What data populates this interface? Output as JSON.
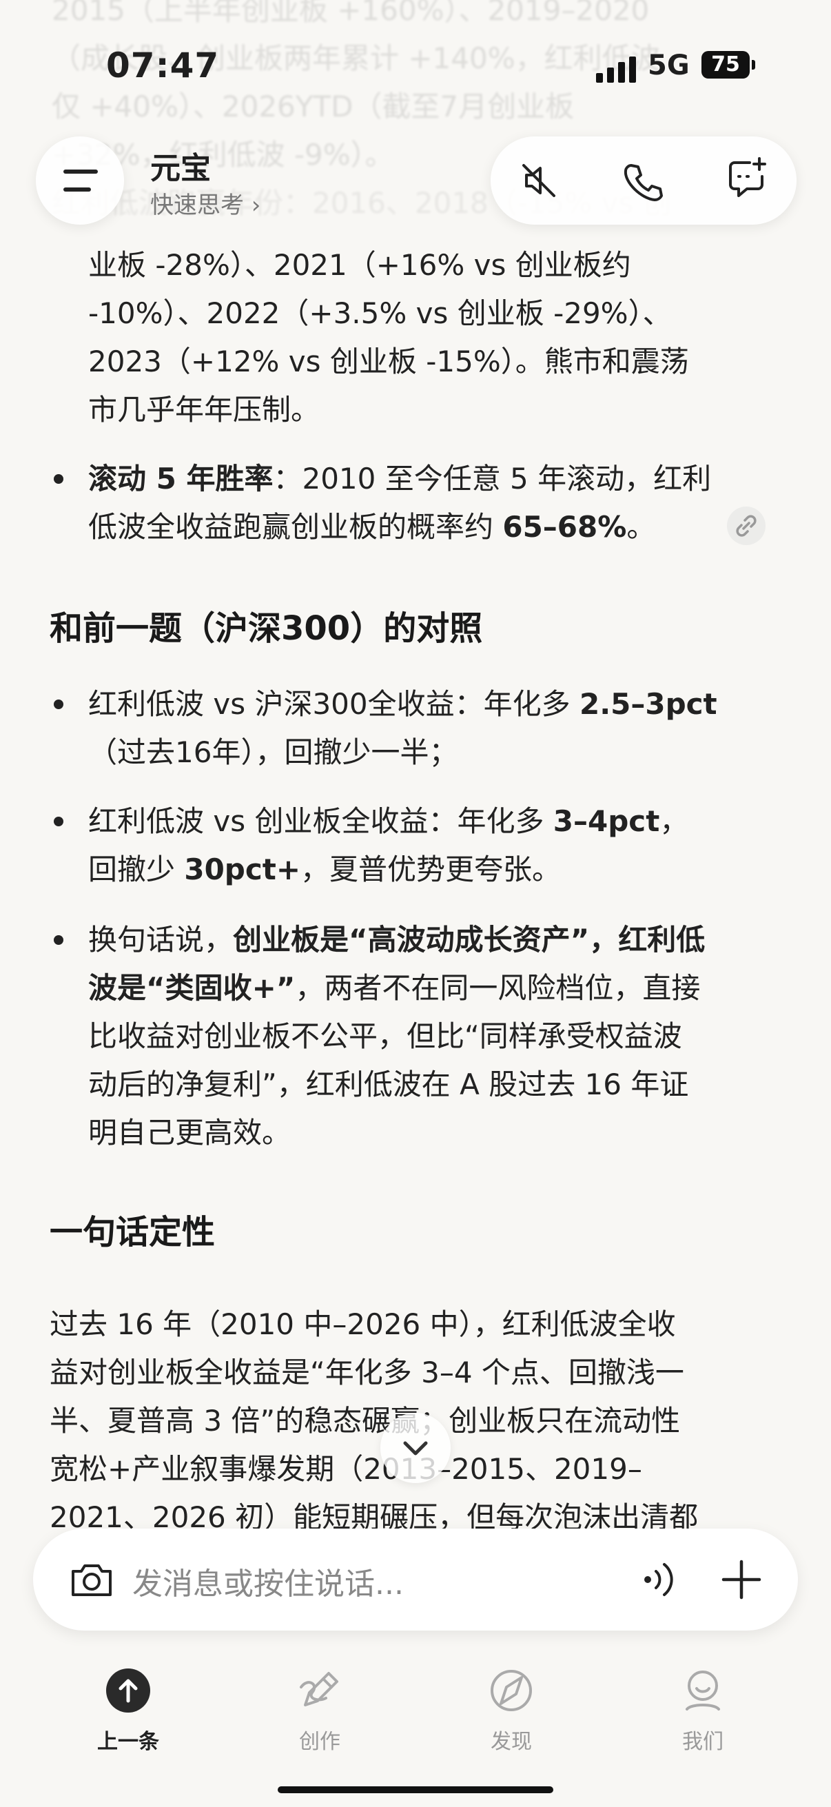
{
  "status_bar": {
    "time": "07:47",
    "network": "5G",
    "battery": "75"
  },
  "header": {
    "title": "元宝",
    "subtitle": "快速思考 ›"
  },
  "ghost_lines": [
    "2015（上半年创业板 +160%）、2019–2020",
    "（成长股、创业板两年累计 +140%，红利低波",
    "仅 +40%）、2026YTD（截至7月创业板",
    "+32%，红利低波 -9%）。",
    "红利低波跑赢年份：2016、2018（-15% vs 创"
  ],
  "content": {
    "para_top": [
      "业板 -28%）、2021（+16% vs 创业板约",
      "-10%）、2022（+3.5% vs 创业板 -29%）、",
      "2023（+12% vs 创业板 -15%）。熊市和震荡",
      "市几乎年年压制。"
    ],
    "rolling": {
      "label": "滚动 5 年胜率",
      "line1_rest": "：2010 至今任意 5 年滚动，红利",
      "line2_a": "低波全收益跑赢创业板的概率约 ",
      "line2_b": "65–68%",
      "line2_c": "。"
    },
    "h_compare": "和前一题（沪深300）的对照",
    "compare_1": {
      "a": "红利低波 vs 沪深300全收益：年化多 ",
      "b": "2.5–3pct",
      "line2": "（过去16年），回撤少一半；"
    },
    "compare_2": {
      "a": "红利低波 vs 创业板全收益：年化多 ",
      "b": "3–4pct",
      "c": "，",
      "line2_a": "回撤少 ",
      "line2_b": "30pct+",
      "line2_c": "，夏普优势更夸张。"
    },
    "compare_3": {
      "a": "换句话说，",
      "b": "创业板是“高波动成长资产”，红利低",
      "line2_a": "波是“类固收+”",
      "line2_b": "，两者不在同一风险档位，直接",
      "line3": "比收益对创业板不公平，但比“同样承受权益波",
      "line4": "动后的净复利”，红利低波在 A 股过去 16 年证",
      "line5": "明自己更高效。"
    },
    "h_summary": "一句话定性",
    "summary": [
      "过去 16 年（2010 中–2026 中），红利低波全收",
      "益对创业板全收益是“年化多 3–4 个点、回撤浅一",
      "半、夏普高 3 倍”的稳态碾赢；创业板只在流动性",
      "宽松+产业叙事爆发期（2013–2015、2019–",
      "2021、2026 初）能短期碾压，但每次泡沫出清都"
    ]
  },
  "input": {
    "placeholder": "发消息或按住说话..."
  },
  "tabs": [
    {
      "label": "上一条",
      "icon": "up-arrow-icon"
    },
    {
      "label": "创作",
      "icon": "pen-icon"
    },
    {
      "label": "发现",
      "icon": "compass-icon"
    },
    {
      "label": "我们",
      "icon": "person-icon"
    }
  ]
}
